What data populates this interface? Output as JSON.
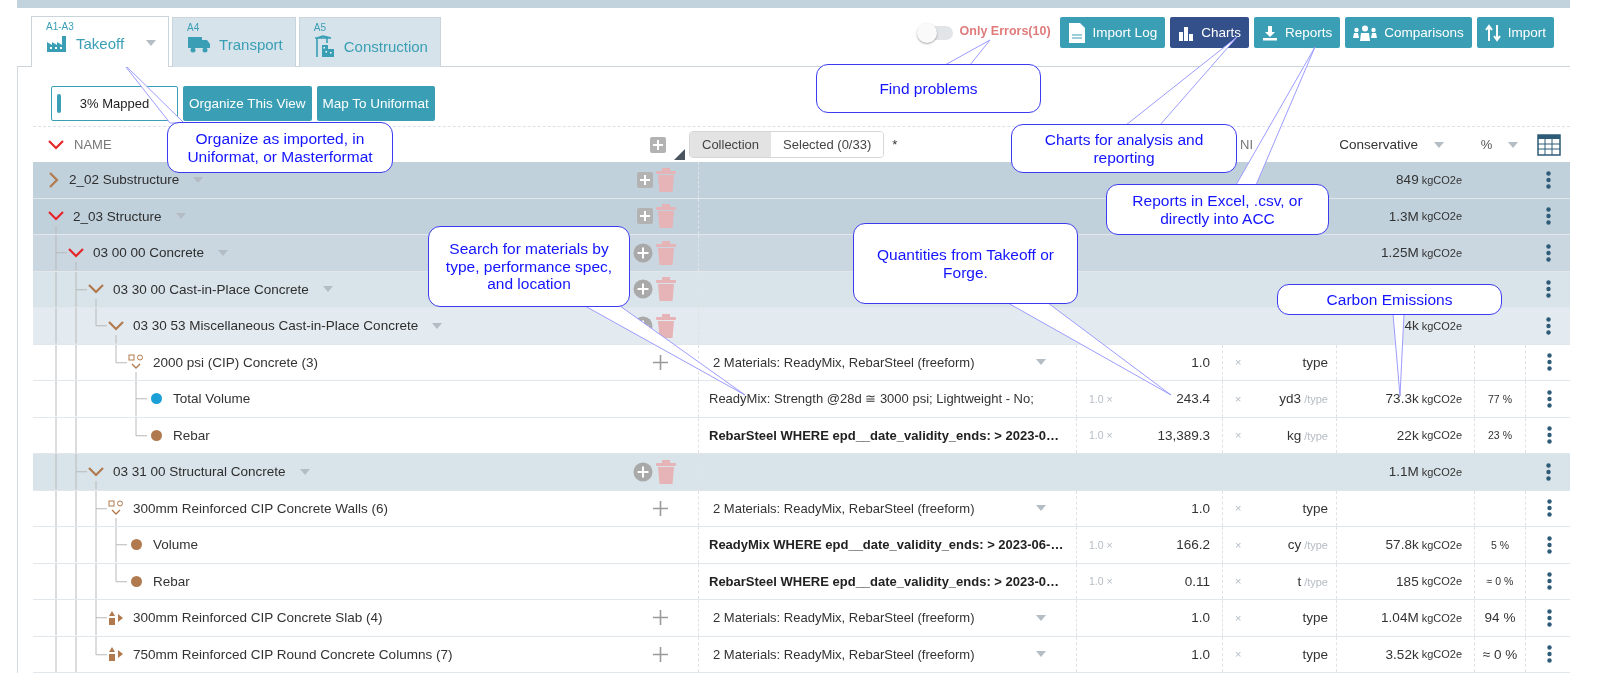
{
  "tabs": [
    {
      "code": "A1-A3",
      "label": "Takeoff",
      "selected": true
    },
    {
      "code": "A4",
      "label": "Transport",
      "selected": false
    },
    {
      "code": "A5",
      "label": "Construction",
      "selected": false
    }
  ],
  "error_filter": {
    "label": "Only Errors(10)",
    "on": false
  },
  "actions": [
    {
      "label": "Import Log",
      "selected": false
    },
    {
      "label": "Charts",
      "selected": true
    },
    {
      "label": "Reports",
      "selected": false
    },
    {
      "label": "Comparisons",
      "selected": false
    },
    {
      "label": "Import",
      "selected": false
    }
  ],
  "mapping": {
    "label": "3% Mapped",
    "level": 0.03
  },
  "view_buttons": [
    "Organize This View",
    "Map To Uniformat"
  ],
  "table": {
    "name_header": "NAME",
    "scope_options": [
      {
        "label": "Collection",
        "selected": true
      },
      {
        "label": "Selected (0/33)",
        "selected": false
      }
    ],
    "scope_mark": "*",
    "column_5_fragment": "NI",
    "carbon_header": "Conservative",
    "percent_header": "%",
    "rows": [
      {
        "kind": "group",
        "label": "2_02 Substructure",
        "expanded": false,
        "carbon": "849",
        "carbon_unit": "kgCO2e"
      },
      {
        "kind": "group",
        "label": "2_03 Structure",
        "expanded": true,
        "carbon": "1.3M",
        "carbon_unit": "kgCO2e",
        "children": [
          {
            "kind": "group",
            "label": "03 00 00 Concrete",
            "expanded": true,
            "carbon": "1.25M",
            "carbon_unit": "kgCO2e",
            "children": [
              {
                "kind": "group",
                "label": "03 30 00 Cast-in-Place Concrete",
                "expanded": true,
                "children": [
                  {
                    "kind": "group",
                    "label": "03 30 53 Miscellaneous Cast-in-Place Concrete",
                    "expanded": true,
                    "carbon": "4k",
                    "carbon_unit": "kgCO2e",
                    "children": [
                      {
                        "kind": "assembly",
                        "label": "2000 psi (CIP) Concrete (3)",
                        "expanded": true,
                        "materials": "2 Materials: ReadyMix, RebarSteel (freeform)",
                        "quantity": "1.0",
                        "times": "×",
                        "unit": "type",
                        "children": [
                          {
                            "kind": "material",
                            "label": "Total Volume",
                            "color": "#1a9fd6",
                            "bold": false,
                            "materials": "ReadyMix: Strength @28d ≅ 3000 psi; Lightweight - No;",
                            "factor": "1.0 ×",
                            "quantity": "243.4",
                            "times": "×",
                            "unit": "yd3",
                            "per": "/type",
                            "carbon": "73.3k",
                            "carbon_unit": "kgCO2e",
                            "share": "77 %"
                          },
                          {
                            "kind": "material",
                            "label": "Rebar",
                            "color": "#b07a4e",
                            "bold": true,
                            "materials": "RebarSteel WHERE epd__date_validity_ends: > 2023-0…",
                            "factor": "1.0 ×",
                            "quantity": "13,389.3",
                            "times": "×",
                            "unit": "kg",
                            "per": "/type",
                            "carbon": "22k",
                            "carbon_unit": "kgCO2e",
                            "share": "23 %"
                          }
                        ]
                      }
                    ]
                  }
                ]
              },
              {
                "kind": "group",
                "label": "03 31 00 Structural Concrete",
                "expanded": true,
                "carbon": "1.1M",
                "carbon_unit": "kgCO2e",
                "children": [
                  {
                    "kind": "assembly",
                    "label": "300mm Reinforced CIP Concrete Walls (6)",
                    "expanded": true,
                    "materials": "2 Materials: ReadyMix, RebarSteel (freeform)",
                    "quantity": "1.0",
                    "times": "×",
                    "unit": "type",
                    "children": [
                      {
                        "kind": "material",
                        "label": "Volume",
                        "color": "#b07a4e",
                        "bold": true,
                        "materials": "ReadyMix WHERE epd__date_validity_ends: > 2023-06-…",
                        "factor": "1.0 ×",
                        "quantity": "166.2",
                        "times": "×",
                        "unit": "cy",
                        "per": "/type",
                        "carbon": "57.8k",
                        "carbon_unit": "kgCO2e",
                        "share": "5 %"
                      },
                      {
                        "kind": "material",
                        "label": "Rebar",
                        "color": "#b07a4e",
                        "bold": true,
                        "materials": "RebarSteel WHERE epd__date_validity_ends: > 2023-0…",
                        "factor": "1.0 ×",
                        "quantity": "0.11",
                        "times": "×",
                        "unit": "t",
                        "per": "/type",
                        "carbon": "185",
                        "carbon_unit": "kgCO2e",
                        "share": "≈ 0 %"
                      }
                    ]
                  },
                  {
                    "kind": "assembly",
                    "label": "300mm Reinforced CIP Concrete Slab (4)",
                    "expanded": false,
                    "materials": "2 Materials: ReadyMix, RebarSteel (freeform)",
                    "quantity": "1.0",
                    "times": "×",
                    "unit": "type",
                    "carbon": "1.04M",
                    "carbon_unit": "kgCO2e",
                    "share": "94 %"
                  },
                  {
                    "kind": "assembly",
                    "label": "750mm Reinforced CIP Round Concrete Columns (7)",
                    "expanded": false,
                    "materials": "2 Materials: ReadyMix, RebarSteel (freeform)",
                    "quantity": "1.0",
                    "times": "×",
                    "unit": "type",
                    "carbon": "3.52k",
                    "carbon_unit": "kgCO2e",
                    "share": "≈ 0 %"
                  }
                ]
              }
            ]
          }
        ]
      }
    ]
  },
  "callouts": [
    "Organize as imported, in Uniformat, or Masterformat",
    "Find problems",
    "Charts for analysis and reporting",
    "Reports in Excel, .csv, or directly into ACC",
    "Search for materials by type, performance spec, and location",
    "Quantities from Takeoff or Forge.",
    "Carbon Emissions"
  ]
}
